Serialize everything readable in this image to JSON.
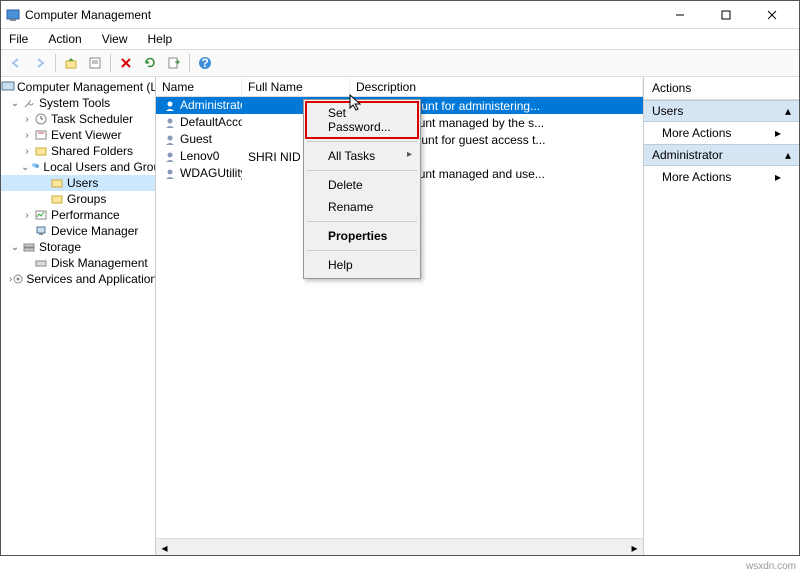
{
  "title": "Computer Management",
  "menubar": [
    "File",
    "Action",
    "View",
    "Help"
  ],
  "tree": {
    "root": "Computer Management (Local",
    "system_tools": "System Tools",
    "task_scheduler": "Task Scheduler",
    "event_viewer": "Event Viewer",
    "shared_folders": "Shared Folders",
    "local_users": "Local Users and Groups",
    "users": "Users",
    "groups": "Groups",
    "performance": "Performance",
    "device_manager": "Device Manager",
    "storage": "Storage",
    "disk_management": "Disk Management",
    "services_apps": "Services and Applications"
  },
  "list": {
    "headers": {
      "name": "Name",
      "fullname": "Full Name",
      "description": "Description"
    },
    "rows": [
      {
        "name": "Administrator",
        "fullname": "",
        "desc": "Built-in account for administering..."
      },
      {
        "name": "DefaultAcco...",
        "fullname": "",
        "desc": "A user account managed by the s..."
      },
      {
        "name": "Guest",
        "fullname": "",
        "desc": "Built-in account for guest access t..."
      },
      {
        "name": "Lenov0",
        "fullname": "SHRI NID",
        "desc": ""
      },
      {
        "name": "WDAGUtility...",
        "fullname": "",
        "desc": "A user account managed and use..."
      }
    ]
  },
  "contextmenu": {
    "set_password": "Set Password...",
    "all_tasks": "All Tasks",
    "delete": "Delete",
    "rename": "Rename",
    "properties": "Properties",
    "help": "Help"
  },
  "actions": {
    "title": "Actions",
    "users": "Users",
    "more1": "More Actions",
    "administrator": "Administrator",
    "more2": "More Actions"
  },
  "watermark": "wsxdn.com"
}
